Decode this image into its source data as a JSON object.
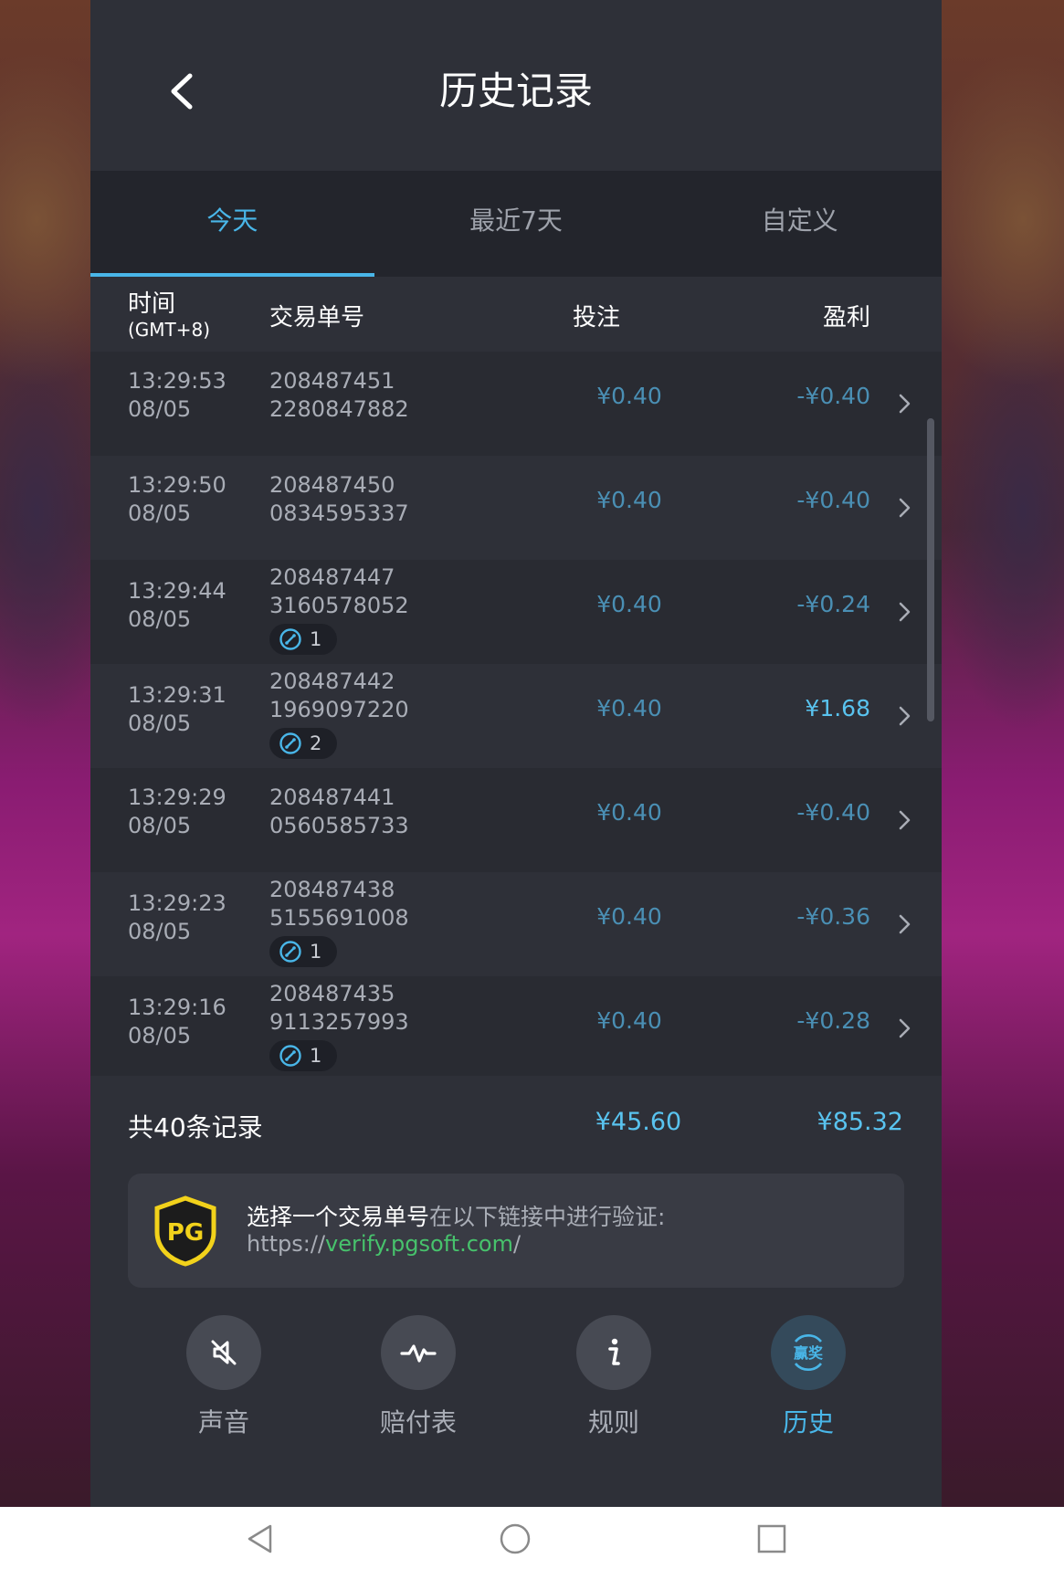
{
  "header": {
    "title": "历史记录",
    "back_icon": "chevron-left-icon"
  },
  "tabs": [
    {
      "label": "今天",
      "active": true
    },
    {
      "label": "最近7天",
      "active": false
    },
    {
      "label": "自定义",
      "active": false
    }
  ],
  "columns": {
    "time": "时间",
    "timezone": "(GMT+8)",
    "txn": "交易单号",
    "bet": "投注",
    "profit": "盈利"
  },
  "rows": [
    {
      "time": "13:29:53",
      "date": "08/05",
      "txn1": "208487451",
      "txn2": "2280847882",
      "free_spins": "",
      "bet": "¥0.40",
      "profit": "-¥0.40"
    },
    {
      "time": "13:29:50",
      "date": "08/05",
      "txn1": "208487450",
      "txn2": "0834595337",
      "free_spins": "",
      "bet": "¥0.40",
      "profit": "-¥0.40"
    },
    {
      "time": "13:29:44",
      "date": "08/05",
      "txn1": "208487447",
      "txn2": "3160578052",
      "free_spins": "1",
      "bet": "¥0.40",
      "profit": "-¥0.24"
    },
    {
      "time": "13:29:31",
      "date": "08/05",
      "txn1": "208487442",
      "txn2": "1969097220",
      "free_spins": "2",
      "bet": "¥0.40",
      "profit": "¥1.68"
    },
    {
      "time": "13:29:29",
      "date": "08/05",
      "txn1": "208487441",
      "txn2": "0560585733",
      "free_spins": "",
      "bet": "¥0.40",
      "profit": "-¥0.40"
    },
    {
      "time": "13:29:23",
      "date": "08/05",
      "txn1": "208487438",
      "txn2": "5155691008",
      "free_spins": "1",
      "bet": "¥0.40",
      "profit": "-¥0.36"
    },
    {
      "time": "13:29:16",
      "date": "08/05",
      "txn1": "208487435",
      "txn2": "9113257993",
      "free_spins": "1",
      "bet": "¥0.40",
      "profit": "-¥0.28"
    }
  ],
  "summary": {
    "label": "共40条记录",
    "total_bet": "¥45.60",
    "total_profit": "¥85.32"
  },
  "verify": {
    "logo_text": "PG",
    "line1_main": "选择一个交易单号",
    "line1_rest": "在以下链接中进行验证:",
    "link_prefix": "https://",
    "link_domain": "verify.pgsoft.com",
    "link_suffix": "/"
  },
  "nav": [
    {
      "label": "声音",
      "icon": "sound-off-icon",
      "active": false
    },
    {
      "label": "赔付表",
      "icon": "paytable-icon",
      "active": false
    },
    {
      "label": "规则",
      "icon": "info-icon",
      "active": false
    },
    {
      "label": "历史",
      "icon": "history-icon",
      "icon_text": "赢奖",
      "active": true
    }
  ],
  "colors": {
    "accent": "#49b6e8",
    "panel": "#2e3038",
    "link": "#47c26c"
  }
}
